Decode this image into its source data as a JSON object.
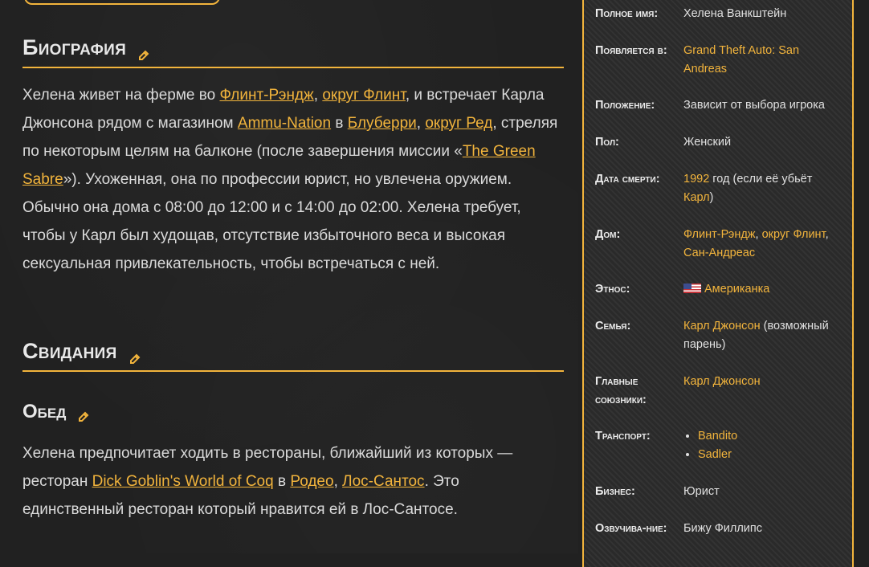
{
  "biography": {
    "heading": "Биография",
    "paragraph": {
      "t1": "Хелена живет на ферме во ",
      "l1": "Флинт-Рэндж",
      "t2": ", ",
      "l2": "округ Флинт",
      "t3": ", и встречает Карла Джонсона рядом с магазином ",
      "l3": "Ammu-Nation",
      "t4": " в ",
      "l4": "Блуберри",
      "t5": ", ",
      "l5": "округ Ред",
      "t6": ", стреляя по некоторым целям на балконе (после завершения миссии «",
      "l6": "The Green Sabre",
      "t7": "»). Ухоженная, она по профессии юрист, но увлечена оружием. Обычно она дома с 08:00 до 12:00 и с 14:00 до 02:00. Хелена требует, чтобы у Карл был худощав, отсутствие избыточного веса и высокая сексуальная привлекательность, чтобы встречаться с ней."
    }
  },
  "dates": {
    "heading": "Свидания"
  },
  "lunch": {
    "heading": "Обед",
    "paragraph": {
      "t1": "Хелена предпочитает ходить в рестораны, ближайший из которых — ресторан ",
      "l1": "Dick Goblin's World of Coq",
      "t2": " в ",
      "l2": "Родео",
      "t3": ", ",
      "l3": "Лос-Сантос",
      "t4": ". Это единственный ресторан который нравится ей в Лос-Сантосе."
    }
  },
  "infobox": {
    "full_name": {
      "label": "Полное имя:",
      "value": "Хелена Ванкштейн"
    },
    "appears_in": {
      "label": "Появляется в:",
      "link": "Grand Theft Auto: San Andreas"
    },
    "status": {
      "label": "Положение:",
      "value": "Зависит от выбора игрока"
    },
    "gender": {
      "label": "Пол:",
      "value": "Женский"
    },
    "death": {
      "label": "Дата смерти:",
      "link1": "1992",
      "text1": " год (если её убьёт ",
      "link2": "Карл",
      "text2": ")"
    },
    "home": {
      "label": "Дом:",
      "link1": "Флинт-Рэндж",
      "sep1": ", ",
      "link2": "округ Флинт",
      "sep2": ", ",
      "link3": "Сан-Андреас"
    },
    "ethnicity": {
      "label": "Этнос:",
      "link": "Американка",
      "flag_icon": "us-flag-icon"
    },
    "family": {
      "label": "Семья:",
      "link": "Карл Джонсон",
      "text": " (возможный парень)"
    },
    "allies": {
      "label": "Главные союзники:",
      "link": "Карл Джонсон"
    },
    "vehicles": {
      "label": "Транспорт:",
      "items": [
        "Bandito",
        "Sadler"
      ]
    },
    "business": {
      "label": "Бизнес:",
      "value": "Юрист"
    },
    "voice": {
      "label": "Озвучива-ние:",
      "value": "Бижу Филлипс"
    }
  },
  "colors": {
    "accent": "#f2b43c",
    "background": "#212121",
    "text": "#dcdcdc"
  }
}
